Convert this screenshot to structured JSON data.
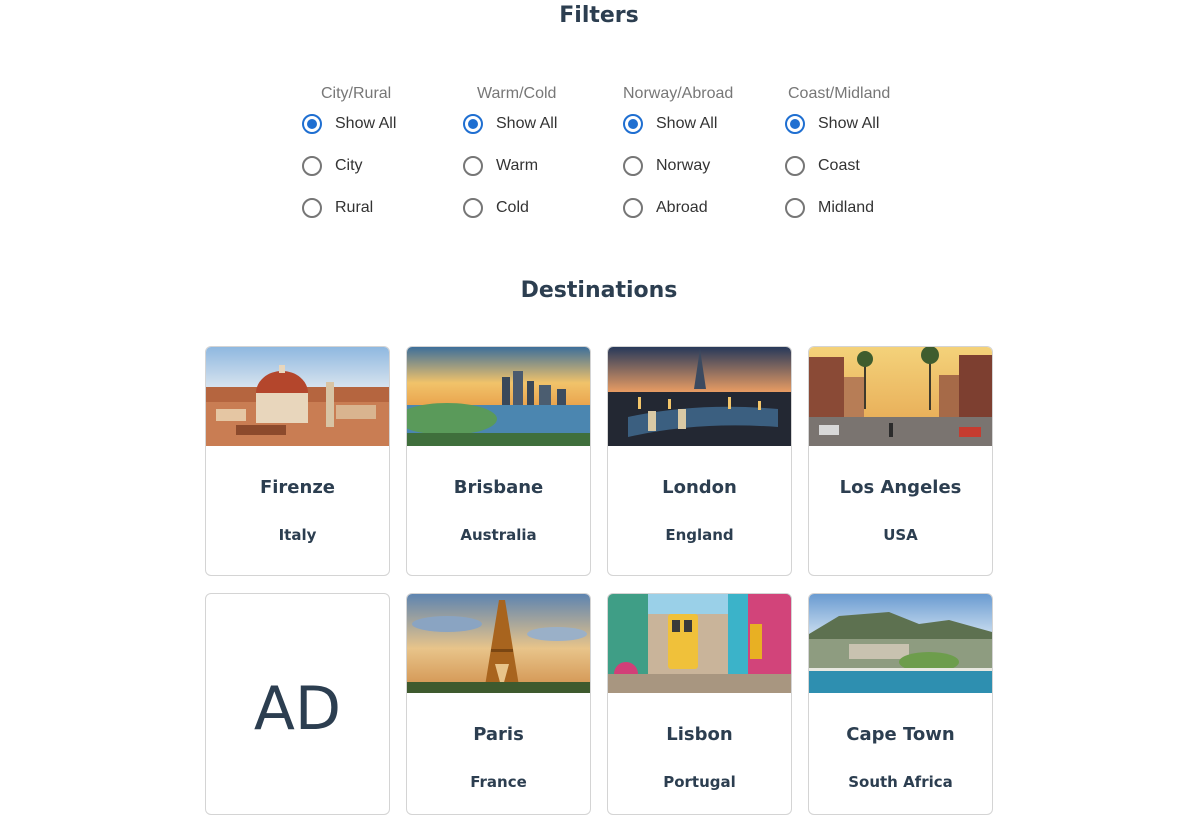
{
  "filters": {
    "title": "Filters",
    "groups": [
      {
        "label": "City/Rural",
        "options": [
          "Show All",
          "City",
          "Rural"
        ],
        "selected": "Show All"
      },
      {
        "label": "Warm/Cold",
        "options": [
          "Show All",
          "Warm",
          "Cold"
        ],
        "selected": "Show All"
      },
      {
        "label": "Norway/Abroad",
        "options": [
          "Show All",
          "Norway",
          "Abroad"
        ],
        "selected": "Show All"
      },
      {
        "label": "Coast/Midland",
        "options": [
          "Show All",
          "Coast",
          "Midland"
        ],
        "selected": "Show All"
      }
    ]
  },
  "destinations": {
    "title": "Destinations",
    "cards": [
      {
        "city": "Firenze",
        "country": "Italy",
        "image": "florence-cathedral-photo"
      },
      {
        "city": "Brisbane",
        "country": "Australia",
        "image": "brisbane-river-skyline-photo"
      },
      {
        "city": "London",
        "country": "England",
        "image": "london-night-skyline-photo"
      },
      {
        "city": "Los Angeles",
        "country": "USA",
        "image": "los-angeles-palm-street-photo"
      },
      {
        "ad": "AD"
      },
      {
        "city": "Paris",
        "country": "France",
        "image": "eiffel-tower-photo"
      },
      {
        "city": "Lisbon",
        "country": "Portugal",
        "image": "lisbon-tram-street-photo"
      },
      {
        "city": "Cape Town",
        "country": "South Africa",
        "image": "cape-town-aerial-photo"
      }
    ]
  },
  "colors": {
    "accent": "#1f6fd1",
    "heading": "#2c3e50",
    "border": "#d4d4d4"
  }
}
